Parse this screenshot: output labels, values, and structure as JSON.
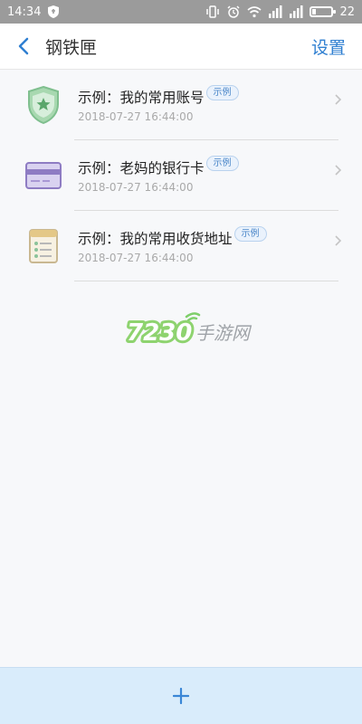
{
  "status_bar": {
    "time": "14:34",
    "battery_level": "22",
    "battery_fraction": 0.22
  },
  "header": {
    "title": "钢铁匣",
    "settings_label": "设置"
  },
  "items": [
    {
      "title": "示例：我的常用账号",
      "badge": "示例",
      "time": "2018-07-27  16:44:00",
      "icon": "shield-star-icon"
    },
    {
      "title": "示例：老妈的银行卡",
      "badge": "示例",
      "time": "2018-07-27  16:44:00",
      "icon": "bank-card-icon"
    },
    {
      "title": "示例：我的常用收货地址",
      "badge": "示例",
      "time": "2018-07-27  16:44:00",
      "icon": "address-note-icon"
    }
  ],
  "watermark": {
    "number": "7230",
    "text": "手游网"
  },
  "colors": {
    "accent": "#2f7fd1",
    "status_bar": "#9b9b9b",
    "bottom_bar": "#d9ecfb",
    "shield": "#7fbf8e",
    "card_purple": "#8e7cc3",
    "note_tan": "#e4c887"
  }
}
